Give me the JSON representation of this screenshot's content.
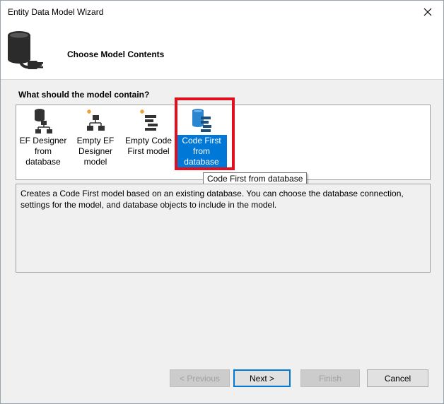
{
  "window": {
    "title": "Entity Data Model Wizard"
  },
  "header": {
    "title": "Choose Model Contents"
  },
  "question": "What should the model contain?",
  "model_options": [
    {
      "label": "EF Designer from database",
      "icon": "ef-designer-database-icon",
      "selected": false
    },
    {
      "label": "Empty EF Designer model",
      "icon": "empty-ef-designer-icon",
      "selected": false
    },
    {
      "label": "Empty Code First model",
      "icon": "empty-code-first-icon",
      "selected": false
    },
    {
      "label": "Code First from database",
      "icon": "code-first-database-icon",
      "selected": true
    }
  ],
  "tooltip": "Code First from database",
  "description": "Creates a Code First model based on an existing database. You can choose the database connection, settings for the model, and database objects to include in the model.",
  "buttons": {
    "previous": "< Previous",
    "next": "Next >",
    "finish": "Finish",
    "cancel": "Cancel"
  },
  "colors": {
    "selection": "#0078d7",
    "highlight": "#e0101e"
  }
}
